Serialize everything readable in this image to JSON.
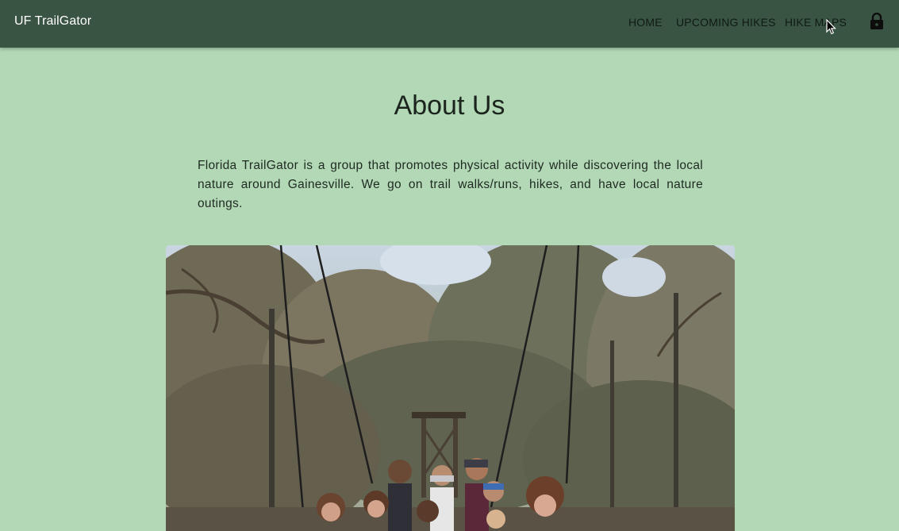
{
  "appbar": {
    "brand": "UF TrailGator",
    "nav": [
      {
        "label": "HOME"
      },
      {
        "label": "UPCOMING HIKES"
      },
      {
        "label": "HIKE MAPS"
      }
    ],
    "lock_icon": "lock-icon",
    "background": "#3a5443"
  },
  "main": {
    "title": "About Us",
    "description": "Florida TrailGator is a group that promotes physical activity while discovering the local nature around Gainesville. We go on trail walks/runs, hikes, and have local nature outings.",
    "photo_icon": "group-photo",
    "background": "#b2d8b5"
  }
}
